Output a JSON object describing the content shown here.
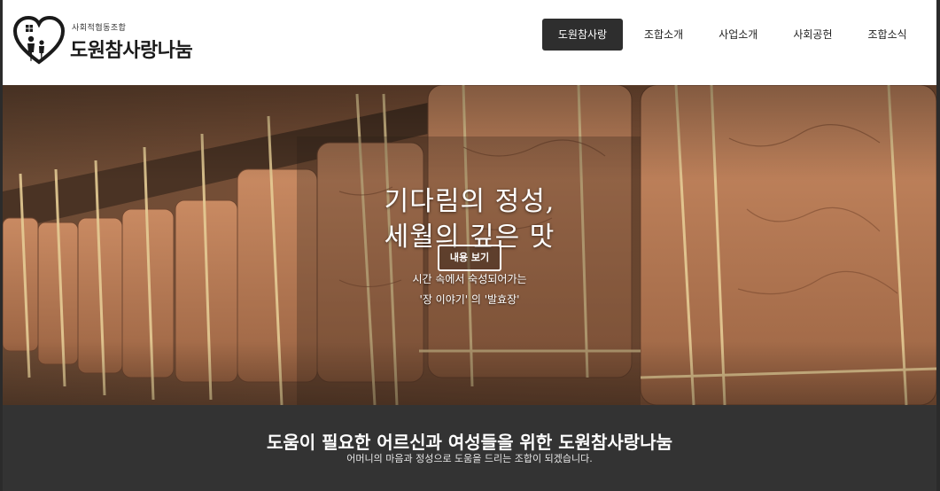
{
  "logo": {
    "subtitle": "사회적협동조합",
    "name": "도원참사랑나눔",
    "icon": "heart-family-logo-icon"
  },
  "nav": {
    "items": [
      {
        "label": "도원참사랑",
        "active": true
      },
      {
        "label": "조합소개",
        "active": false
      },
      {
        "label": "사업소개",
        "active": false
      },
      {
        "label": "사회공헌",
        "active": false
      },
      {
        "label": "조합소식",
        "active": false
      }
    ]
  },
  "hero": {
    "title_line1": "기다림의 정성,",
    "title_line2": "세월의 깊은 맛",
    "button_label": "내용 보기",
    "sub_line1": "시간 속에서 숙성되어가는",
    "sub_line2": "'장 이야기' 의 '발효장'"
  },
  "intro": {
    "title": "도움이 필요한 어르신과 여성들을 위한 도원참사랑나눔",
    "subtitle": "어머니의 마음과 정성으로 도움을 드리는 조합이 되겠습니다."
  },
  "colors": {
    "nav_active_bg": "#2e2e2e",
    "intro_bg": "#333333",
    "frame": "#2b2b2b"
  }
}
